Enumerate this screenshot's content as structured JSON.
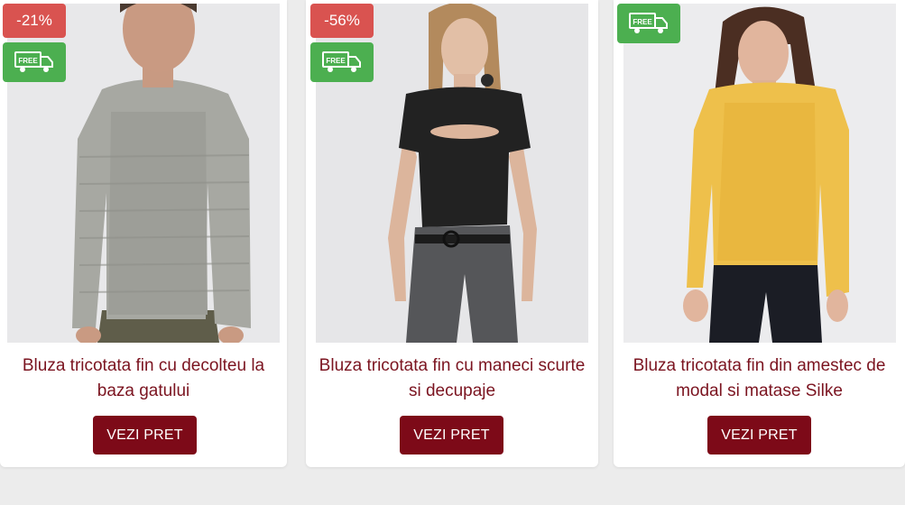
{
  "products": [
    {
      "discount": "-21%",
      "free_badge": "FREE",
      "title_lines": [
        "Bluza tricotata fin cu decolteu la",
        "baza gatului"
      ],
      "button": "VEZI PRET",
      "image": "man-grey-knit-sweater"
    },
    {
      "discount": "-56%",
      "free_badge": "FREE",
      "title_lines": [
        "Bluza tricotata fin cu maneci scurte",
        "si decupaje"
      ],
      "button": "VEZI PRET",
      "image": "woman-black-cutout-top"
    },
    {
      "discount": null,
      "free_badge": "FREE",
      "title_lines": [
        "Bluza tricotata fin din amestec de",
        "modal si matase Silke"
      ],
      "button": "VEZI PRET",
      "image": "woman-yellow-sweater"
    }
  ],
  "colors": {
    "title": "#7b1420",
    "button": "#7d0a18",
    "discount_badge": "#d95350",
    "free_badge": "#4caf50"
  }
}
